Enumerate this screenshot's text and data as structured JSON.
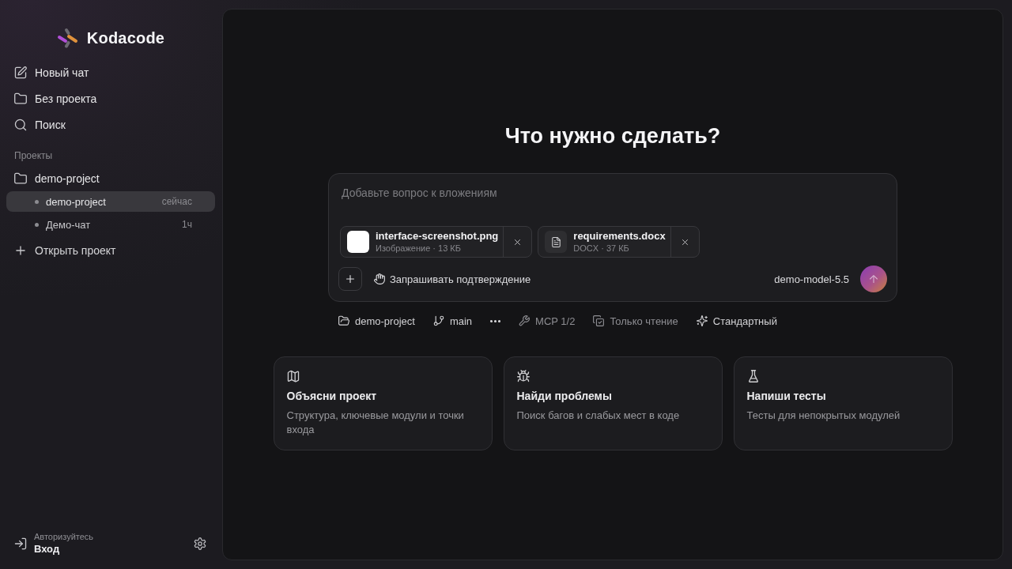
{
  "sidebar": {
    "logo": {
      "text": "Kodacode"
    },
    "nav": [
      {
        "kind": "new-chat",
        "label": "Новый чат"
      },
      {
        "kind": "folder",
        "label": "Без проекта"
      },
      {
        "kind": "search",
        "label": "Поиск"
      }
    ],
    "section_label": "Проекты",
    "projects": [
      {
        "label": "demo-project",
        "children": [
          {
            "label": "demo-project",
            "time": "сейчас",
            "selected": true
          },
          {
            "label": "Демо-чат",
            "time": "1ч",
            "selected": false
          }
        ]
      }
    ],
    "open_project": {
      "label": "Открыть проект"
    },
    "account": {
      "caption": "Авторизуйтесь",
      "action": "Вход"
    }
  },
  "main": {
    "heading": "Что нужно сделать?",
    "composer": {
      "placeholder": "Добавьте вопрос к вложениям",
      "attachments": [
        {
          "kind": "image",
          "name": "interface-screenshot.png",
          "meta": "Изображение · 13 КБ"
        },
        {
          "kind": "document",
          "name": "requirements.docx",
          "meta": "DOCX · 37 КБ"
        }
      ],
      "approval": "Запрашивать подтверждение",
      "model": "demo-model-5.5"
    },
    "context_bar": [
      {
        "kind": "folder",
        "label": "demo-project",
        "active": true
      },
      {
        "kind": "branch",
        "label": "main",
        "active": true
      },
      {
        "kind": "more",
        "active": true
      },
      {
        "kind": "mcp",
        "label": "MCP 1/2",
        "active": false
      },
      {
        "kind": "read-only",
        "label": "Только чтение",
        "active": false
      },
      {
        "kind": "mode",
        "label": "Стандартный",
        "active": true
      }
    ],
    "suggestions": [
      {
        "kind": "map",
        "title": "Объясни проект",
        "description": "Структура, ключевые модули и точки входа"
      },
      {
        "kind": "bug",
        "title": "Найди проблемы",
        "description": "Поиск багов и слабых мест в коде"
      },
      {
        "kind": "flask",
        "title": "Напиши тесты",
        "description": "Тесты для непокрытых модулей"
      }
    ]
  }
}
